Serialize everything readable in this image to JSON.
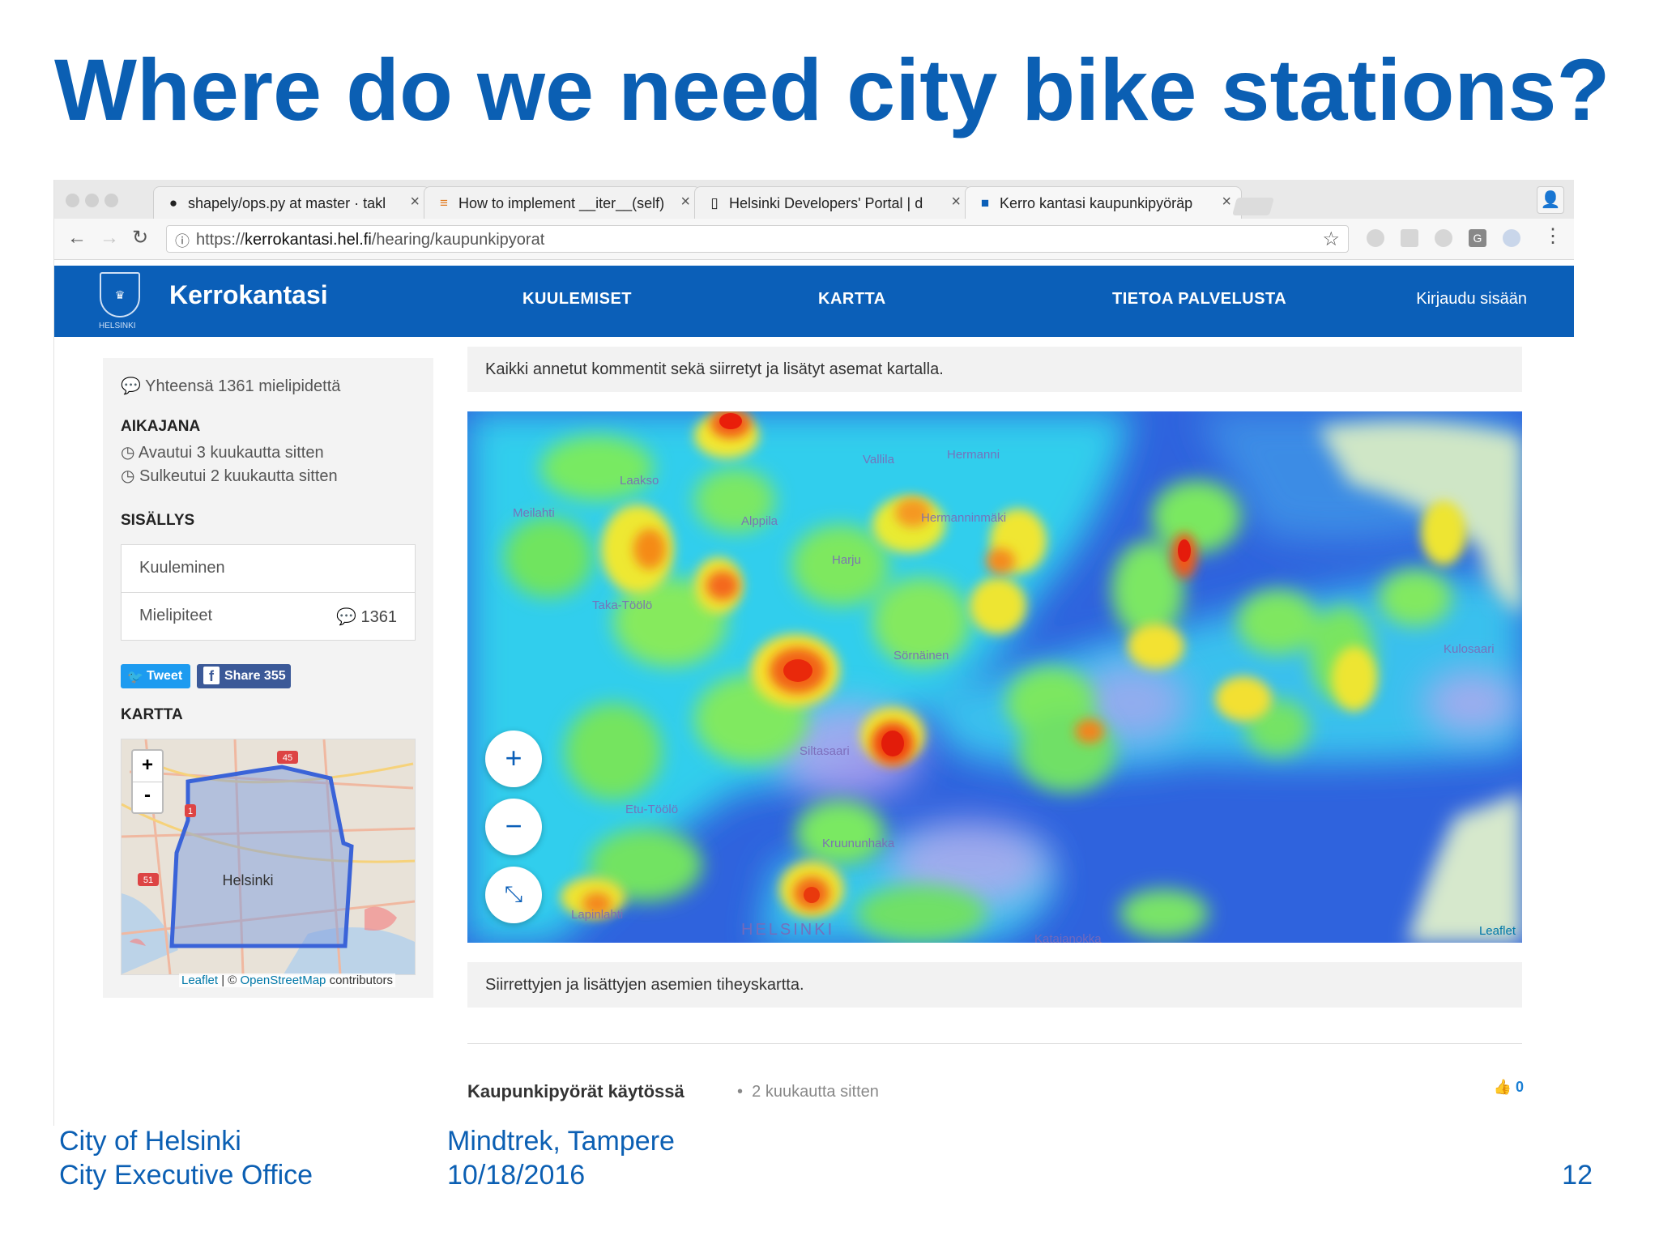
{
  "slide": {
    "title": "Where do we need city bike stations?",
    "footer_left_1": "City of Helsinki",
    "footer_left_2": "City Executive Office",
    "footer_mid_1": "Mindtrek, Tampere",
    "footer_mid_2": "10/18/2016",
    "page_number": "12",
    "accent_color": "#0b5fb3"
  },
  "browser": {
    "tabs": [
      {
        "label": "shapely/ops.py at master · takl",
        "icon": "github-icon",
        "active": false
      },
      {
        "label": "How to implement __iter__(self)",
        "icon": "stackoverflow-icon",
        "active": false
      },
      {
        "label": "Helsinki Developers' Portal | d",
        "icon": "page-icon",
        "active": false
      },
      {
        "label": "Kerro kantasi kaupunkipyöräp",
        "icon": "kerrokantasi-icon",
        "active": true
      }
    ],
    "url_scheme": "https://",
    "url_host": "kerrokantasi.hel.fi",
    "url_path": "/hearing/kaupunkipyorat"
  },
  "site": {
    "crest_label": "HELSINKI",
    "brand": "Kerrokantasi",
    "nav": [
      "KUULEMISET",
      "KARTTA",
      "TIETOA PALVELUSTA"
    ],
    "login": "Kirjaudu sisään",
    "header_color": "#0b5fb8"
  },
  "sidebar": {
    "comment_total": "Yhteensä 1361 mielipidettä",
    "timeline_heading": "AIKAJANA",
    "opened": "Avautui 3 kuukautta sitten",
    "closed": "Sulkeutui 2 kuukautta sitten",
    "contents_heading": "SISÄLLYS",
    "toc": [
      {
        "label": "Kuuleminen",
        "count": ""
      },
      {
        "label": "Mielipiteet",
        "count": "1361"
      }
    ],
    "tweet_label": "Tweet",
    "share_label": "Share 355",
    "map_heading": "KARTTA",
    "minimap_city_label": "Helsinki",
    "minimap_road_labels": [
      "45",
      "1",
      "51"
    ],
    "minimap_zoom_in": "+",
    "minimap_zoom_out": "-",
    "attribution_leaflet": "Leaflet",
    "attribution_sep": " | © ",
    "attribution_osm": "OpenStreetMap",
    "attribution_tail": " contributors"
  },
  "main": {
    "intro_caption": "Kaikki annetut kommentit sekä siirretyt ja lisätyt asemat kartalla.",
    "heatmap_caption": "Siirrettyjen ja lisättyjen asemien tiheyskartta.",
    "map_labels": [
      "Laakso",
      "Vallila",
      "Hermanni",
      "Meilahti",
      "Alppila",
      "Hermanninmäki",
      "Harju",
      "Taka-Töölö",
      "Sörnäinen",
      "Kulosaari",
      "Siltasaari",
      "Etu-Töölö",
      "Kruununhaka",
      "HELSINKI",
      "Lapinlahti",
      "Katajanokka"
    ],
    "zoom_in": "+",
    "zoom_out": "−",
    "fullscreen_icon": "⤡",
    "leaflet_label": "Leaflet",
    "comment_title": "Kaupunkipyörät käytössä",
    "comment_dot": "•",
    "comment_time": "2 kuukautta sitten",
    "likes": "0"
  }
}
